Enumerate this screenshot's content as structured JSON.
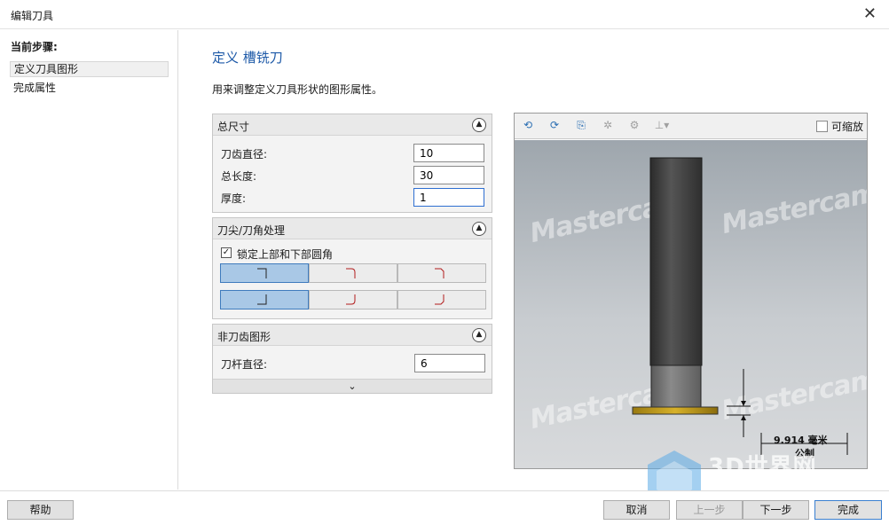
{
  "window": {
    "title": "编辑刀具",
    "close_glyph": "✕"
  },
  "sidebar": {
    "heading": "当前步骤:",
    "items": [
      {
        "label": "定义刀具图形",
        "selected": true
      },
      {
        "label": "完成属性",
        "selected": false
      }
    ]
  },
  "main": {
    "title": "定义 槽铣刀",
    "description": "用来调整定义刀具形状的图形属性。"
  },
  "overall": {
    "title": "总尺寸",
    "fields": [
      {
        "label": "刀齿直径:",
        "value": "10"
      },
      {
        "label": "总长度:",
        "value": "30"
      },
      {
        "label": "厚度:",
        "value": "1"
      }
    ]
  },
  "corner": {
    "title": "刀尖/刀角处理",
    "checkbox_label": "锁定上部和下部圆角",
    "checked": true,
    "top_row": [
      "square",
      "radius",
      "chamfer"
    ],
    "bottom_row": [
      "square",
      "radius",
      "chamfer"
    ],
    "selected_top": 0,
    "selected_bottom": 0
  },
  "non_cutting": {
    "title": "非刀齿图形",
    "fields": [
      {
        "label": "刀杆直径:",
        "value": "6"
      }
    ]
  },
  "preview": {
    "toolbar_icons": [
      "rotate-left-icon",
      "rotate-right-icon",
      "reset-view-icon",
      "wireframe-icon",
      "shaded-icon",
      "tool-orientation-icon"
    ],
    "scale_label": "可缩放",
    "scale_checked": false,
    "watermark": "Mastercam",
    "dimension_value": "9.914 毫米",
    "dimension_unit": "公制",
    "colors": {
      "shank": "#4a4a4a",
      "cutter": "#c9a21a"
    }
  },
  "footer": {
    "help": "帮助",
    "cancel": "取消",
    "back": "上一步",
    "next": "下一步",
    "finish": "完成"
  },
  "overlay_logo": "3D世界网"
}
